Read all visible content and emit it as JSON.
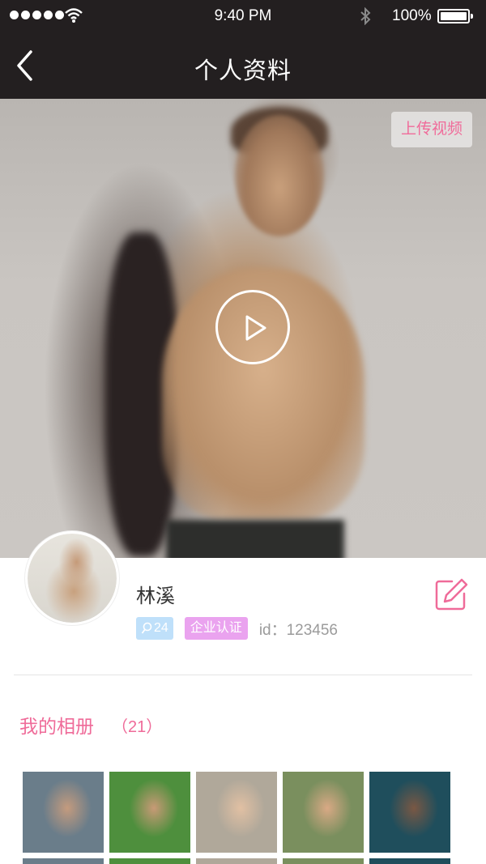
{
  "status_bar": {
    "time": "9:40 PM",
    "battery": "100%",
    "battery_level": 1.0
  },
  "nav": {
    "title": "个人资料"
  },
  "video": {
    "upload_label": "上传视频"
  },
  "profile": {
    "name": "林溪",
    "level": "24",
    "cert_label": "企业认证",
    "id_text": "id：123456"
  },
  "album": {
    "title": "我的相册",
    "count": "（21）",
    "thumbs": [
      {
        "colors": [
          "#6a7d8a",
          "#c49b7e"
        ]
      },
      {
        "colors": [
          "#4e8f3d",
          "#c89a76"
        ]
      },
      {
        "colors": [
          "#b0a89a",
          "#e1c0a3"
        ]
      },
      {
        "colors": [
          "#7a8f5e",
          "#d9a985"
        ]
      },
      {
        "colors": [
          "#1f4e5c",
          "#7a5844"
        ]
      }
    ]
  },
  "colors": {
    "accent": "#ef6b99",
    "nav_bg": "#231f20",
    "level_badge": "#bfe0fa",
    "cert_badge": "#eaa3ef"
  }
}
